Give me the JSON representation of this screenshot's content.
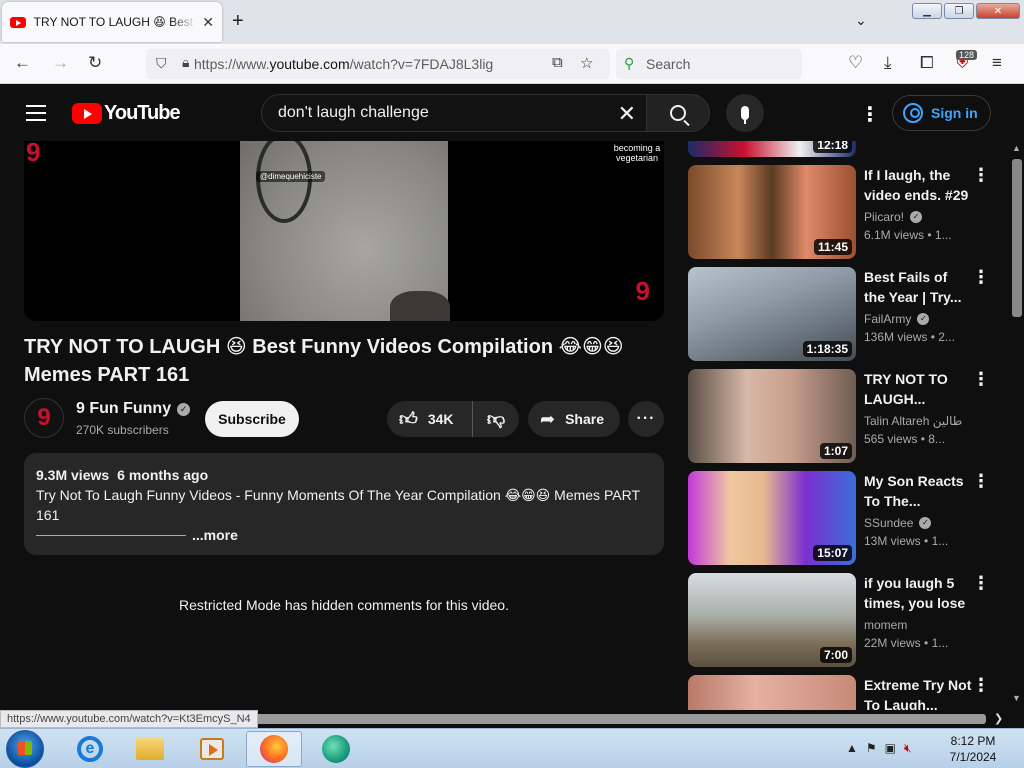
{
  "browser": {
    "tab_title": "TRY NOT TO LAUGH 😆 Best Fu",
    "url_prefix": "https://www.",
    "url_domain": "youtube.com",
    "url_path": "/watch?v=7FDAJ8L3lig",
    "search_placeholder": "Search",
    "extension_badge": "128",
    "status_link": "https://www.youtube.com/watch?v=Kt3EmcyS_N4"
  },
  "youtube": {
    "logo_text": "YouTube",
    "search_query": "don't laugh challenge",
    "sign_in_label": "Sign in"
  },
  "video": {
    "overlay_tag": "@dimequehiciste",
    "overlay_caption": "becoming a vegetarian",
    "corner_logo": "9",
    "title": "TRY NOT TO LAUGH 😆 Best Funny Videos Compilation 😂😁😆 Memes PART 161",
    "channel_name": "9 Fun Funny",
    "channel_avatar_text": "9",
    "subscribers": "270K subscribers",
    "subscribe_label": "Subscribe",
    "likes": "34K",
    "share_label": "Share",
    "views": "9.3M views",
    "age": "6 months ago",
    "description": "Try Not To Laugh Funny Videos - Funny Moments Of The Year Compilation 😂😁😆 Memes PART 161",
    "more_label": "...more",
    "restricted_notice": "Restricted Mode has hidden comments for this video."
  },
  "sidebar": {
    "partial_top_duration": "12:18",
    "items": [
      {
        "title": "If I laugh, the video ends. #29",
        "channel": "Piicaro!",
        "verified": true,
        "views": "6.1M views",
        "age": "• 1...",
        "duration": "11:45",
        "thumb": "linear-gradient(90deg,#7a4a2a 0%,#c8875a 30%,#5a3a22 50%,#e08a6a 70%,#9a5030 100%)"
      },
      {
        "title": "Best Fails of the Year | Try...",
        "channel": "FailArmy",
        "verified": true,
        "views": "136M views",
        "age": "• 2...",
        "duration": "1:18:35",
        "thumb": "linear-gradient(160deg,#b9c3cc 0%,#8e9aa5 40%,#6a747d 70%,#434a52 100%)"
      },
      {
        "title": "TRY NOT TO LAUGH...",
        "channel": "Talin Altareh طالين",
        "verified": false,
        "views": "565 views",
        "age": "• 8...",
        "duration": "1:07",
        "thumb": "linear-gradient(90deg,#5a4f46 0%,#d7b8a6 35%,#caa08e 60%,#6e5d52 100%)"
      },
      {
        "title": "My Son Reacts To The...",
        "channel": "SSundee",
        "verified": true,
        "views": "13M views",
        "age": "• 1...",
        "duration": "15:07",
        "thumb": "linear-gradient(90deg,#c13ad9 0%,#f0c9a0 25%,#e8b890 45%,#7b2fd0 70%,#3a6ed8 100%)"
      },
      {
        "title": "if you laugh 5 times, you lose",
        "channel": "momem",
        "verified": false,
        "views": "22M views",
        "age": "• 1...",
        "duration": "7:00",
        "thumb": "linear-gradient(180deg,#d8dde2 0%,#a9aea8 45%,#7e6e58 75%,#5a5040 100%)"
      },
      {
        "title": "Extreme Try Not To Laugh...",
        "channel": "",
        "verified": false,
        "views": "",
        "age": "",
        "duration": "",
        "thumb": "linear-gradient(90deg,#b87a68 0%,#e6b0a0 40%,#c88a78 100%)"
      }
    ]
  },
  "taskbar": {
    "time": "8:12 PM",
    "date": "7/1/2024"
  },
  "colors": {
    "youtube_red": "#ff0000",
    "link_blue": "#3ea6ff",
    "bg": "#0f0f0f"
  }
}
